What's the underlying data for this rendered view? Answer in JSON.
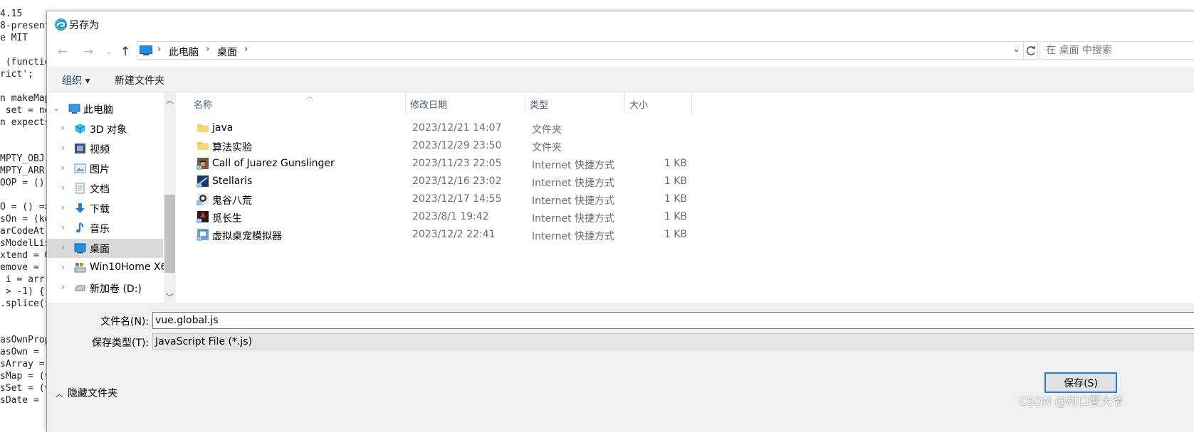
{
  "background_code": {
    "lines": [
      "4.15",
      "8-present",
      "e MIT",
      "",
      " (functio",
      "rict';",
      "",
      "n makeMap",
      " set = ne",
      "n expects",
      "",
      "",
      "MPTY_OBJ ",
      "MPTY_ARR ",
      "OOP = ()",
      "",
      "O = () =>",
      "sOn = (ke",
      "arCodeAt(",
      "sModelLis",
      "xtend = O",
      "emove = (",
      " i = arr.",
      " > -1) {",
      ".splice(i",
      "",
      "",
      "asOwnProp",
      "asOwn = (",
      "sArray = ",
      "sMap = (v",
      "sSet = (v",
      "sDate = ("
    ]
  },
  "dialog": {
    "title": "另存为",
    "address": {
      "segments": [
        "此电脑",
        "桌面"
      ],
      "search_placeholder": "在 桌面 中搜索"
    },
    "toolbar": {
      "organize": "组织 ▾",
      "new_folder": "新建文件夹"
    },
    "nav_tree": [
      {
        "label": "此电脑",
        "icon": "computer-icon"
      },
      {
        "label": "3D 对象",
        "icon": "cube-3d-icon"
      },
      {
        "label": "视频",
        "icon": "video-icon"
      },
      {
        "label": "图片",
        "icon": "picture-icon"
      },
      {
        "label": "文档",
        "icon": "document-icon"
      },
      {
        "label": "下载",
        "icon": "download-icon"
      },
      {
        "label": "音乐",
        "icon": "music-icon"
      },
      {
        "label": "桌面",
        "icon": "desktop-icon",
        "selected": true
      },
      {
        "label": "Win10Home X6",
        "icon": "drive-c-icon"
      },
      {
        "label": "新加卷 (D:)",
        "icon": "drive-d-icon"
      }
    ],
    "columns": [
      "名称",
      "修改日期",
      "类型",
      "大小"
    ],
    "files": [
      {
        "name": "java",
        "date": "2023/12/21 14:07",
        "type": "文件夹",
        "size": "",
        "icon": "folder-icon"
      },
      {
        "name": "算法实验",
        "date": "2023/12/29 23:50",
        "type": "文件夹",
        "size": "",
        "icon": "folder-icon"
      },
      {
        "name": "Call of Juarez Gunslinger",
        "date": "2023/11/23 22:05",
        "type": "Internet 快捷方式",
        "size": "1 KB",
        "icon": "game-shortcut-icon"
      },
      {
        "name": "Stellaris",
        "date": "2023/12/16 23:02",
        "type": "Internet 快捷方式",
        "size": "1 KB",
        "icon": "game-shortcut-icon"
      },
      {
        "name": "鬼谷八荒",
        "date": "2023/12/17 14:55",
        "type": "Internet 快捷方式",
        "size": "1 KB",
        "icon": "game-shortcut-icon"
      },
      {
        "name": "觅长生",
        "date": "2023/8/1 19:42",
        "type": "Internet 快捷方式",
        "size": "1 KB",
        "icon": "game-shortcut-icon"
      },
      {
        "name": "虚拟桌宠模拟器",
        "date": "2023/12/2 22:41",
        "type": "Internet 快捷方式",
        "size": "1 KB",
        "icon": "game-shortcut-icon"
      }
    ],
    "form": {
      "filename_label": "文件名(N):",
      "filename_value": "vue.global.js",
      "filetype_label": "保存类型(T):",
      "filetype_value": "JavaScript File (*.js)",
      "hide_folders": "隐藏文件夹",
      "save_button": "保存(S)"
    },
    "watermark": "CSDN @村口曹大爷"
  },
  "colors": {
    "accent": "#2b7bd3",
    "folder": "#f3c34a",
    "selected_row": "#d9d9d9"
  }
}
